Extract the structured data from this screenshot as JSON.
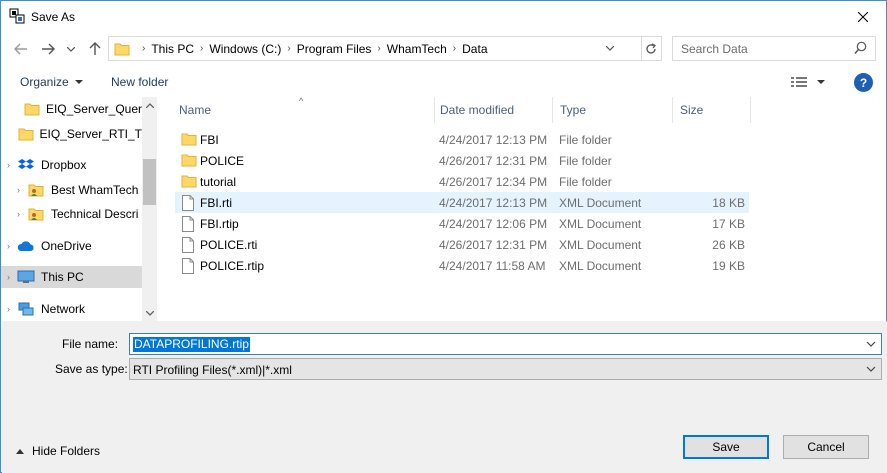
{
  "window": {
    "title": "Save As"
  },
  "nav": {
    "path": [
      "This PC",
      "Windows (C:)",
      "Program Files",
      "WhamTech",
      "Data"
    ],
    "search_placeholder": "Search Data"
  },
  "toolbar": {
    "organize": "Organize",
    "new_folder": "New folder",
    "help": "?"
  },
  "sidebar": {
    "items": [
      {
        "label": "EIQ_Server_Quer",
        "icon": "folder-icon"
      },
      {
        "label": "EIQ_Server_RTI_T",
        "icon": "folder-icon"
      },
      {
        "label": "Dropbox",
        "icon": "dropbox-icon"
      },
      {
        "label": "Best WhamTech",
        "icon": "shared-folder-icon"
      },
      {
        "label": "Technical Descri",
        "icon": "shared-folder-icon"
      },
      {
        "label": "OneDrive",
        "icon": "cloud-icon"
      },
      {
        "label": "This PC",
        "icon": "computer-icon",
        "selected": true
      },
      {
        "label": "Network",
        "icon": "network-icon"
      }
    ]
  },
  "columns": {
    "name": "Name",
    "date": "Date modified",
    "type": "Type",
    "size": "Size"
  },
  "files": [
    {
      "name": "FBI",
      "date": "4/24/2017 12:13 PM",
      "type": "File folder",
      "size": "",
      "kind": "folder"
    },
    {
      "name": "POLICE",
      "date": "4/26/2017 12:31 PM",
      "type": "File folder",
      "size": "",
      "kind": "folder"
    },
    {
      "name": "tutorial",
      "date": "4/26/2017 12:34 PM",
      "type": "File folder",
      "size": "",
      "kind": "folder"
    },
    {
      "name": "FBI.rti",
      "date": "4/24/2017 12:13 PM",
      "type": "XML Document",
      "size": "18 KB",
      "kind": "file",
      "selected": true
    },
    {
      "name": "FBI.rtip",
      "date": "4/24/2017 12:06 PM",
      "type": "XML Document",
      "size": "17 KB",
      "kind": "file"
    },
    {
      "name": "POLICE.rti",
      "date": "4/26/2017 12:31 PM",
      "type": "XML Document",
      "size": "26 KB",
      "kind": "file"
    },
    {
      "name": "POLICE.rtip",
      "date": "4/24/2017 11:58 AM",
      "type": "XML Document",
      "size": "19 KB",
      "kind": "file"
    }
  ],
  "save": {
    "file_name_label": "File name:",
    "file_name": "DATAPROFILING.rtip",
    "type_label": "Save as type:",
    "type_value": "RTI Profiling Files(*.xml)|*.xml"
  },
  "footer": {
    "hide_folders": "Hide Folders",
    "save": "Save",
    "cancel": "Cancel"
  },
  "colors": {
    "accent": "#0078d7",
    "folder": "#ffd767",
    "selection": "#e5f3ff"
  }
}
